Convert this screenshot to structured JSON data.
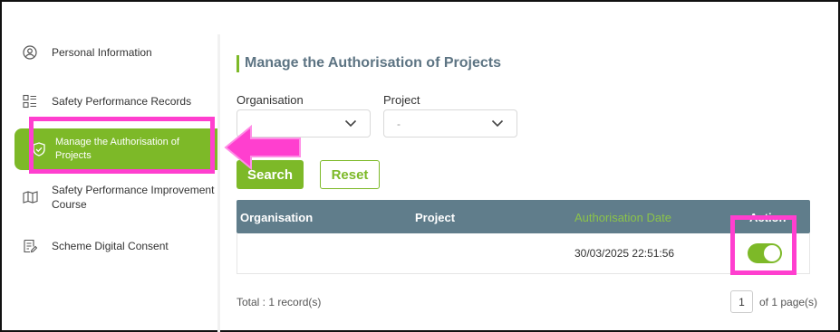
{
  "sidebar": {
    "items": [
      {
        "label": "Personal Information",
        "icon": "user-circle-icon"
      },
      {
        "label": "Safety Performance Records",
        "icon": "list-icon"
      },
      {
        "label_line1": "Manage the Authorisation of",
        "label_line2": "Projects",
        "icon": "shield-check-icon",
        "active": true
      },
      {
        "label_line1": "Safety Performance Improvement",
        "label_line2": "Course",
        "icon": "book-icon"
      },
      {
        "label": "Scheme Digital Consent",
        "icon": "document-edit-icon"
      }
    ]
  },
  "main": {
    "title": "Manage the Authorisation of Projects",
    "filters": {
      "organisation_label": "Organisation",
      "organisation_value": "",
      "project_label": "Project",
      "project_value": "-"
    },
    "buttons": {
      "search": "Search",
      "reset": "Reset"
    },
    "table": {
      "columns": [
        "Organisation",
        "Project",
        "Authorisation Date",
        "Action"
      ],
      "rows": [
        {
          "organisation": "",
          "project": "",
          "authorisation_date": "30/03/2025 22:51:56",
          "action_enabled": true
        }
      ]
    },
    "footer": {
      "total": "Total : 1 record(s)",
      "page": "1",
      "of_pages": "of 1 page(s)"
    }
  },
  "colors": {
    "accent": "#7db928",
    "header": "#607d8b",
    "highlight": "#ff3fcf"
  }
}
